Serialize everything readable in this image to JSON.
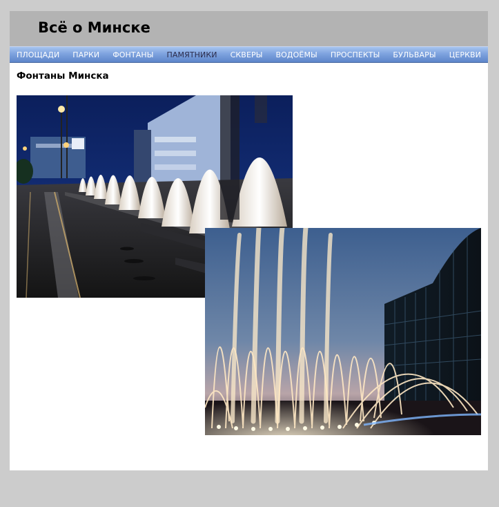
{
  "site": {
    "title": "Всё о Минске"
  },
  "nav": {
    "items": [
      {
        "label": "ПЛОЩАДИ",
        "active": false
      },
      {
        "label": "ПАРКИ",
        "active": false
      },
      {
        "label": "ФОНТАНЫ",
        "active": false
      },
      {
        "label": "ПАМЯТНИКИ",
        "active": true
      },
      {
        "label": "СКВЕРЫ",
        "active": false
      },
      {
        "label": "ВОДОЁМЫ",
        "active": false
      },
      {
        "label": "ПРОСПЕКТЫ",
        "active": false
      },
      {
        "label": "БУЛЬВАРЫ",
        "active": false
      },
      {
        "label": "ЦЕРКВИ",
        "active": false
      }
    ]
  },
  "content": {
    "heading": "Фонтаны Минска"
  },
  "colors": {
    "page_background": "#cccccc",
    "header_background": "#b3b3b3",
    "nav_gradient_top": "#a7c4ef",
    "nav_gradient_bottom": "#5d85c9",
    "nav_text": "#ffffff",
    "nav_active_text": "#2b2b4a"
  }
}
